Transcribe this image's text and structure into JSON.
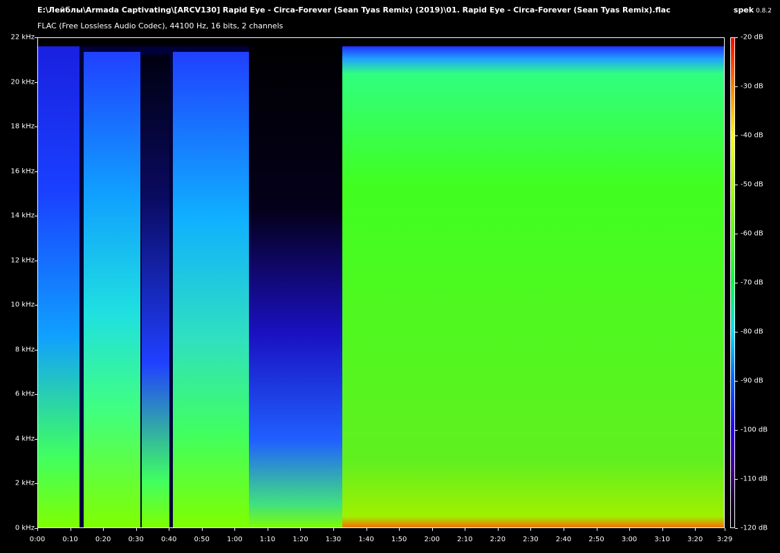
{
  "header": {
    "file_path": "E:\\Лейблы\\Armada Captivating\\[ARCV130] Rapid Eye - Circa-Forever (Sean Tyas Remix) (2019)\\01. Rapid Eye - Circa-Forever (Sean Tyas Remix).flac",
    "file_info": "FLAC (Free Lossless Audio Codec), 44100 Hz, 16 bits, 2 channels",
    "app_name": "spek",
    "app_version": "0.8.2"
  },
  "frequency_axis": {
    "ticks": [
      "22 kHz",
      "20 kHz",
      "18 kHz",
      "16 kHz",
      "14 kHz",
      "12 kHz",
      "10 kHz",
      "8 kHz",
      "6 kHz",
      "4 kHz",
      "2 kHz",
      "0 kHz"
    ],
    "values_khz": [
      22,
      20,
      18,
      16,
      14,
      12,
      10,
      8,
      6,
      4,
      2,
      0
    ]
  },
  "time_axis": {
    "ticks": [
      "0:00",
      "0:10",
      "0:20",
      "0:30",
      "0:40",
      "0:50",
      "1:00",
      "1:10",
      "1:20",
      "1:30",
      "1:40",
      "1:50",
      "2:00",
      "2:10",
      "2:20",
      "2:30",
      "2:40",
      "2:50",
      "3:00",
      "3:10",
      "3:20",
      "3:29"
    ],
    "values_s": [
      0,
      10,
      20,
      30,
      40,
      50,
      60,
      70,
      80,
      90,
      100,
      110,
      120,
      130,
      140,
      150,
      160,
      170,
      180,
      190,
      200,
      209
    ]
  },
  "db_scale": {
    "ticks": [
      "-20 dB",
      "-30 dB",
      "-40 dB",
      "-50 dB",
      "-60 dB",
      "-70 dB",
      "-80 dB",
      "-90 dB",
      "-100 dB",
      "-110 dB",
      "-120 dB"
    ],
    "values_db": [
      -20,
      -30,
      -40,
      -50,
      -60,
      -70,
      -80,
      -90,
      -100,
      -110,
      -120
    ],
    "gradient_colors": [
      "#ff0000",
      "#ff8000",
      "#ffff00",
      "#80ff00",
      "#00ff40",
      "#00e0ff",
      "#0060ff",
      "#2000ff",
      "#400090",
      "#100020",
      "#000000"
    ]
  }
}
